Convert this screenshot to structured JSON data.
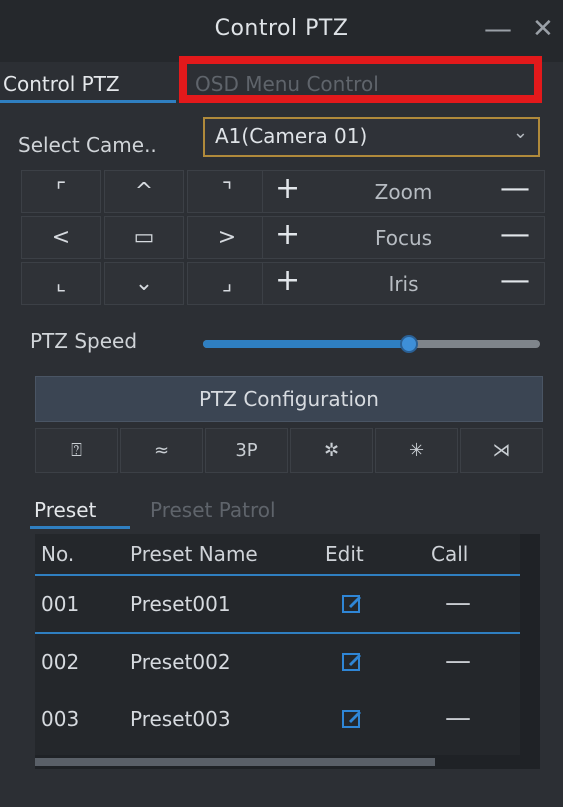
{
  "window": {
    "title": "Control PTZ",
    "minimize_icon": "minimize-icon",
    "close_icon": "close-icon"
  },
  "tabs": [
    {
      "label": "Control PTZ",
      "active": true
    },
    {
      "label": "OSD Menu Control",
      "active": false
    }
  ],
  "camera": {
    "label": "Select Came..",
    "value": "A1(Camera 01)",
    "arrow_icon": "chevron-down-icon"
  },
  "direction_pad": [
    {
      "name": "up-left",
      "glyph": "⌜"
    },
    {
      "name": "up",
      "glyph": "^"
    },
    {
      "name": "up-right",
      "glyph": "⌝"
    },
    {
      "name": "left",
      "glyph": "<"
    },
    {
      "name": "center",
      "glyph": "▭"
    },
    {
      "name": "right",
      "glyph": ">"
    },
    {
      "name": "down-left",
      "glyph": "⌞"
    },
    {
      "name": "down",
      "glyph": "⌄"
    },
    {
      "name": "down-right",
      "glyph": "⌟"
    }
  ],
  "lens": [
    {
      "label": "Zoom",
      "plus": "+",
      "minus": "—"
    },
    {
      "label": "Focus",
      "plus": "+",
      "minus": "—"
    },
    {
      "label": "Iris",
      "plus": "+",
      "minus": "—"
    }
  ],
  "speed": {
    "label": "PTZ Speed",
    "value_fraction": 0.61
  },
  "config_button": "PTZ Configuration",
  "function_icons": [
    {
      "name": "wiper-icon",
      "glyph": "⍰"
    },
    {
      "name": "light-icon",
      "glyph": "≈"
    },
    {
      "name": "3d-positioning-icon",
      "glyph": "3P"
    },
    {
      "name": "light-on-icon",
      "glyph": "✲"
    },
    {
      "name": "light-off-icon",
      "glyph": "✳"
    },
    {
      "name": "wiper-off-icon",
      "glyph": "⋊"
    }
  ],
  "preset_tabs": [
    {
      "label": "Preset",
      "active": true
    },
    {
      "label": "Preset Patrol",
      "active": false
    }
  ],
  "table": {
    "headers": [
      "No.",
      "Preset Name",
      "Edit",
      "Call"
    ],
    "rows": [
      {
        "no": "001",
        "name": "Preset001",
        "call": "—"
      },
      {
        "no": "002",
        "name": "Preset002",
        "call": "—"
      },
      {
        "no": "003",
        "name": "Preset003",
        "call": "—"
      }
    ]
  },
  "colors": {
    "accent": "#2f7fc1",
    "highlight": "#e3191b",
    "select_border": "#b08a3b"
  }
}
